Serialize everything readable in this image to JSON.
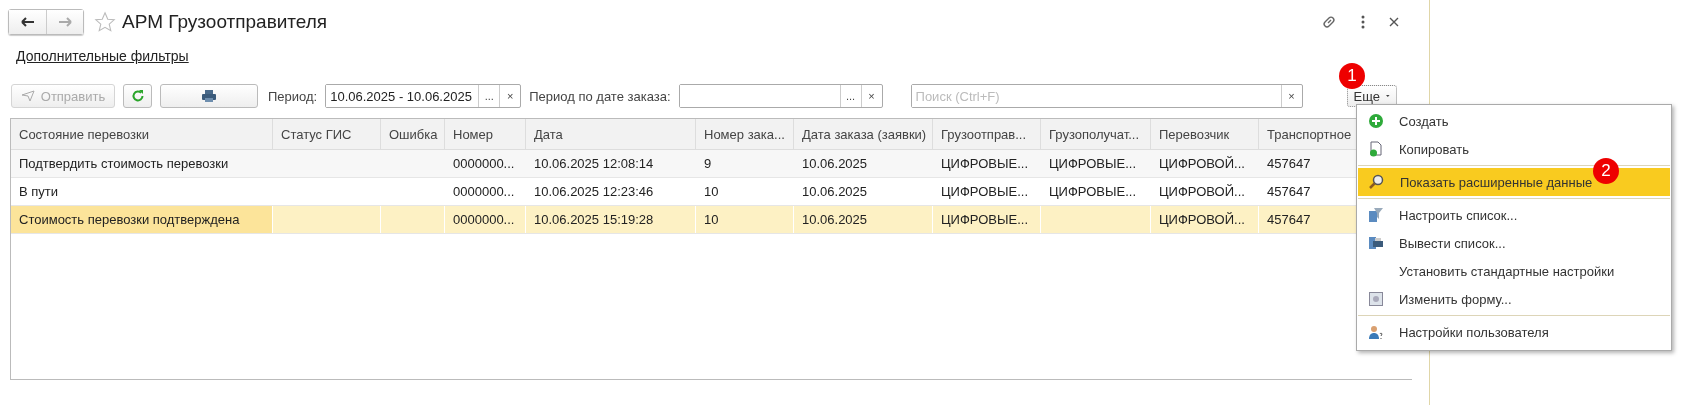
{
  "window": {
    "title": "АРМ Грузоотправителя",
    "favorite": false
  },
  "filters_link": "Дополнительные фильтры",
  "toolbar": {
    "send_button": {
      "label": "Отправить",
      "disabled": true
    },
    "period": {
      "label": "Период:",
      "value": "10.06.2025 - 10.06.2025",
      "choose": "...",
      "clear": "×"
    },
    "order_period": {
      "label": "Период по дате заказа:",
      "choose": "...",
      "clear": "×"
    },
    "search": {
      "placeholder": "Поиск (Ctrl+F)",
      "clear": "×"
    },
    "more_button": {
      "label": "Еще"
    }
  },
  "table": {
    "columns": [
      "Состояние перевозки",
      "Статус ГИС",
      "Ошибка",
      "Номер",
      "Дата",
      "Номер зака...",
      "Дата заказа (заявки)",
      "Грузоотправ...",
      "Грузополучат...",
      "Перевозчик",
      "Транспортное"
    ],
    "rows": [
      {
        "selected": false,
        "cells": [
          "Подтвердить стоимость перевозки",
          "",
          "",
          "0000000...",
          "10.06.2025 12:08:14",
          "9",
          "10.06.2025",
          "ЦИФРОВЫЕ...",
          "ЦИФРОВЫЕ...",
          "ЦИФРОВОЙ...",
          "457647"
        ]
      },
      {
        "selected": false,
        "cells": [
          "В пути",
          "",
          "",
          "0000000...",
          "10.06.2025 12:23:46",
          "10",
          "10.06.2025",
          "ЦИФРОВЫЕ...",
          "ЦИФРОВЫЕ...",
          "ЦИФРОВОЙ...",
          "457647"
        ]
      },
      {
        "selected": true,
        "cells": [
          "Стоимость перевозки подтверждена",
          "",
          "",
          "0000000...",
          "10.06.2025 15:19:28",
          "10",
          "10.06.2025",
          "ЦИФРОВЫЕ...",
          "",
          "ЦИФРОВОЙ...",
          "457647"
        ]
      }
    ]
  },
  "menu": {
    "items": [
      {
        "label": "Создать",
        "kind": "plus",
        "selected": false,
        "separator_before": false
      },
      {
        "label": "Копировать",
        "kind": "copy",
        "selected": false,
        "separator_before": false
      },
      {
        "label": "Показать расширенные данные",
        "kind": "magnifier",
        "selected": true,
        "separator_before": true
      },
      {
        "label": "Настроить список...",
        "kind": "filter",
        "selected": false,
        "separator_before": true
      },
      {
        "label": "Вывести список...",
        "kind": "print",
        "selected": false,
        "separator_before": false
      },
      {
        "label": "Установить стандартные настройки",
        "kind": "plain",
        "selected": false,
        "separator_before": false
      },
      {
        "label": "Изменить форму...",
        "kind": "form",
        "selected": false,
        "separator_before": false
      },
      {
        "label": "Настройки пользователя",
        "kind": "user",
        "selected": false,
        "separator_before": true
      }
    ]
  },
  "annotations": [
    "1",
    "2"
  ]
}
